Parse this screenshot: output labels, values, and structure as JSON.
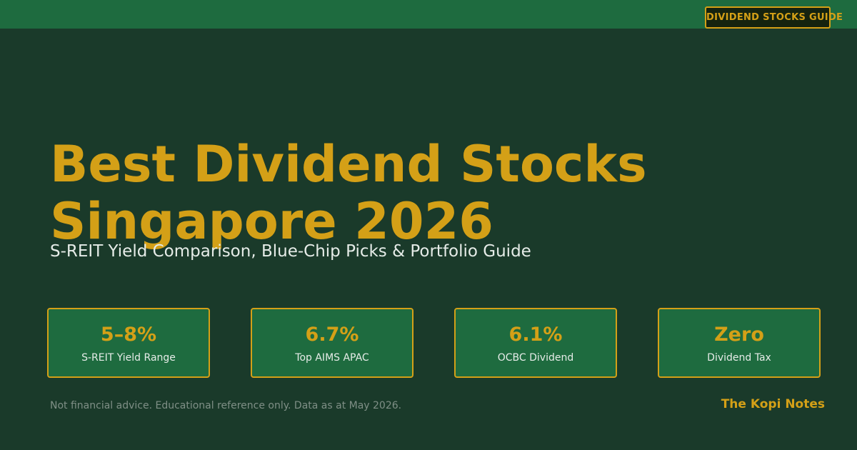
{
  "header": {
    "badge": "DIVIDEND STOCKS GUIDE"
  },
  "hero": {
    "title_line1": "Best Dividend Stocks",
    "title_line2": "Singapore 2026",
    "subtitle": "S-REIT Yield Comparison, Blue-Chip Picks & Portfolio Guide"
  },
  "stats": [
    {
      "value": "5–8%",
      "label": "S-REIT Yield Range"
    },
    {
      "value": "6.7%",
      "label": "Top AIMS APAC"
    },
    {
      "value": "6.1%",
      "label": "OCBC Dividend"
    },
    {
      "value": "Zero",
      "label": "Dividend Tax"
    }
  ],
  "footer": {
    "disclaimer": "Not financial advice. Educational reference only. Data as at May 2026.",
    "brand": "The Kopi Notes"
  },
  "colors": {
    "background": "#1a3a2a",
    "panel_green": "#1e6b3f",
    "accent_gold": "#d4a017",
    "text_light": "#e6ece8",
    "text_muted": "#7f8f86"
  }
}
